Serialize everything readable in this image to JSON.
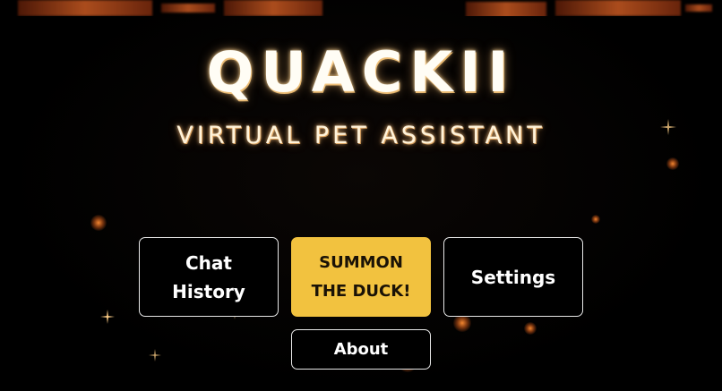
{
  "app": {
    "title": "QUACKII",
    "subtitle": "VIRTUAL PET ASSISTANT"
  },
  "menu": {
    "chat_history": "Chat\nHistory",
    "summon": "SUMMON\nTHE DUCK!",
    "settings": "Settings",
    "about": "About"
  },
  "theme": {
    "background": "#000000",
    "accent": "#f2c23f",
    "glow": "#ff8c32",
    "button_border": "#e8e8e8"
  }
}
